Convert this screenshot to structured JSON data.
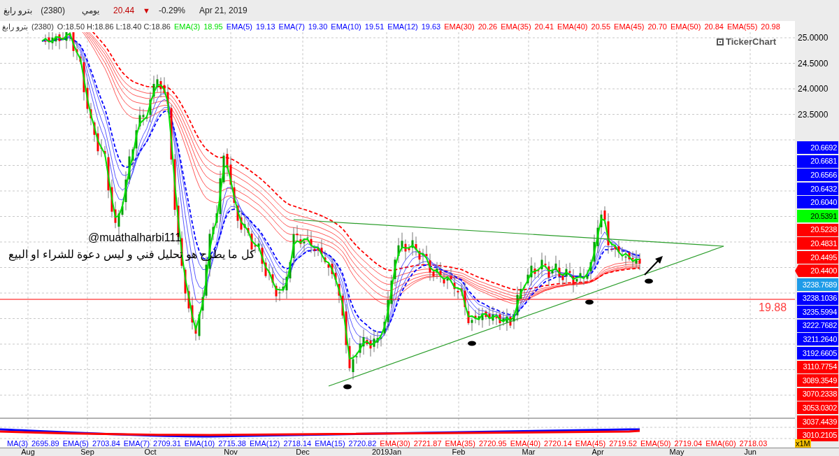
{
  "header": {
    "symbol": "بترو رابغ",
    "code": "(2380)",
    "period": "يومي",
    "price": "20.44",
    "arrow": "▼",
    "change": "-0.29%",
    "date": "Apr 21, 2019"
  },
  "legend": {
    "symbol": "بترو رابغ",
    "code": "(2380)",
    "ohlc": "O:18.50 H:18.86 L:18.40 C:18.86",
    "emas": [
      {
        "label": "EMA(3)",
        "value": "18.95",
        "color": "#00e000"
      },
      {
        "label": "EMA(5)",
        "value": "19.13",
        "color": "#0000ff"
      },
      {
        "label": "EMA(7)",
        "value": "19.30",
        "color": "#0000ff"
      },
      {
        "label": "EMA(10)",
        "value": "19.51",
        "color": "#0000ff"
      },
      {
        "label": "EMA(12)",
        "value": "19.63",
        "color": "#0000ff"
      },
      {
        "label": "EMA(30)",
        "value": "20.26",
        "color": "#ff0000"
      },
      {
        "label": "EMA(35)",
        "value": "20.41",
        "color": "#ff0000"
      },
      {
        "label": "EMA(40)",
        "value": "20.55",
        "color": "#ff0000"
      },
      {
        "label": "EMA(45)",
        "value": "20.70",
        "color": "#ff0000"
      },
      {
        "label": "EMA(50)",
        "value": "20.84",
        "color": "#ff0000"
      },
      {
        "label": "EMA(55)",
        "value": "20.98",
        "color": "#ff0000"
      }
    ]
  },
  "logo": "TickerChart",
  "annotations": {
    "handle": "@muathalharbi111",
    "note": "كل ما يطرح هو تحليل فني  و ليس دعوة للشراء او البيع"
  },
  "level_line": "19.88",
  "y_axis_ticks": [
    "25.0000",
    "24.5000",
    "24.0000",
    "23.5000"
  ],
  "price_labels": [
    {
      "text": "20.6692",
      "color": "#0000ff",
      "current": false
    },
    {
      "text": "20.6681",
      "color": "#0000ff",
      "current": false
    },
    {
      "text": "20.6566",
      "color": "#0000ff",
      "current": false
    },
    {
      "text": "20.6432",
      "color": "#0000ff",
      "current": false
    },
    {
      "text": "20.6040",
      "color": "#0000ff",
      "current": false
    },
    {
      "text": "20.5391",
      "color": "#00ff00",
      "current": false
    },
    {
      "text": "20.5238",
      "color": "#ff0000",
      "current": false
    },
    {
      "text": "20.4831",
      "color": "#ff0000",
      "current": false
    },
    {
      "text": "20.4495",
      "color": "#ff0000",
      "current": false
    },
    {
      "text": "20.4400",
      "color": "#ff0000",
      "current": true
    },
    {
      "text": "3238.7689",
      "color": "#1e9be8",
      "current": false
    },
    {
      "text": "3238.1036",
      "color": "#0000ff",
      "current": false
    },
    {
      "text": "3235.5994",
      "color": "#0000ff",
      "current": false
    },
    {
      "text": "3222.7682",
      "color": "#0000ff",
      "current": false
    },
    {
      "text": "3211.2640",
      "color": "#0000ff",
      "current": false
    },
    {
      "text": "3192.6605",
      "color": "#0000ff",
      "current": false
    },
    {
      "text": "3110.7754",
      "color": "#ff0000",
      "current": false
    },
    {
      "text": "3089.3549",
      "color": "#ff0000",
      "current": false
    },
    {
      "text": "3070.2338",
      "color": "#ff0000",
      "current": false
    },
    {
      "text": "3053.0302",
      "color": "#ff0000",
      "current": false
    },
    {
      "text": "3037.4439",
      "color": "#ff0000",
      "current": false
    },
    {
      "text": "3010.2105",
      "color": "#ff0000",
      "current": false
    }
  ],
  "scale_badge": "x1M",
  "indicator_legend": [
    {
      "label": "MA(3)",
      "value": "2695.89",
      "color": "#0000ff"
    },
    {
      "label": "EMA(5)",
      "value": "2703.84",
      "color": "#0000ff"
    },
    {
      "label": "EMA(7)",
      "value": "2709.31",
      "color": "#0000ff"
    },
    {
      "label": "EMA(10)",
      "value": "2715.38",
      "color": "#0000ff"
    },
    {
      "label": "EMA(12)",
      "value": "2718.14",
      "color": "#0000ff"
    },
    {
      "label": "EMA(15)",
      "value": "2720.82",
      "color": "#0000ff"
    },
    {
      "label": "EMA(30)",
      "value": "2721.87",
      "color": "#ff0000"
    },
    {
      "label": "EMA(35)",
      "value": "2720.95",
      "color": "#ff0000"
    },
    {
      "label": "EMA(40)",
      "value": "2720.14",
      "color": "#ff0000"
    },
    {
      "label": "EMA(45)",
      "value": "2719.52",
      "color": "#ff0000"
    },
    {
      "label": "EMA(50)",
      "value": "2719.04",
      "color": "#ff0000"
    },
    {
      "label": "EMA(60)",
      "value": "2718.03",
      "color": "#ff0000"
    }
  ],
  "x_axis": [
    "Aug",
    "Sep",
    "Oct",
    "Nov",
    "Dec",
    "2019Jan",
    "Feb",
    "Mar",
    "Apr",
    "May",
    "Jun"
  ]
}
